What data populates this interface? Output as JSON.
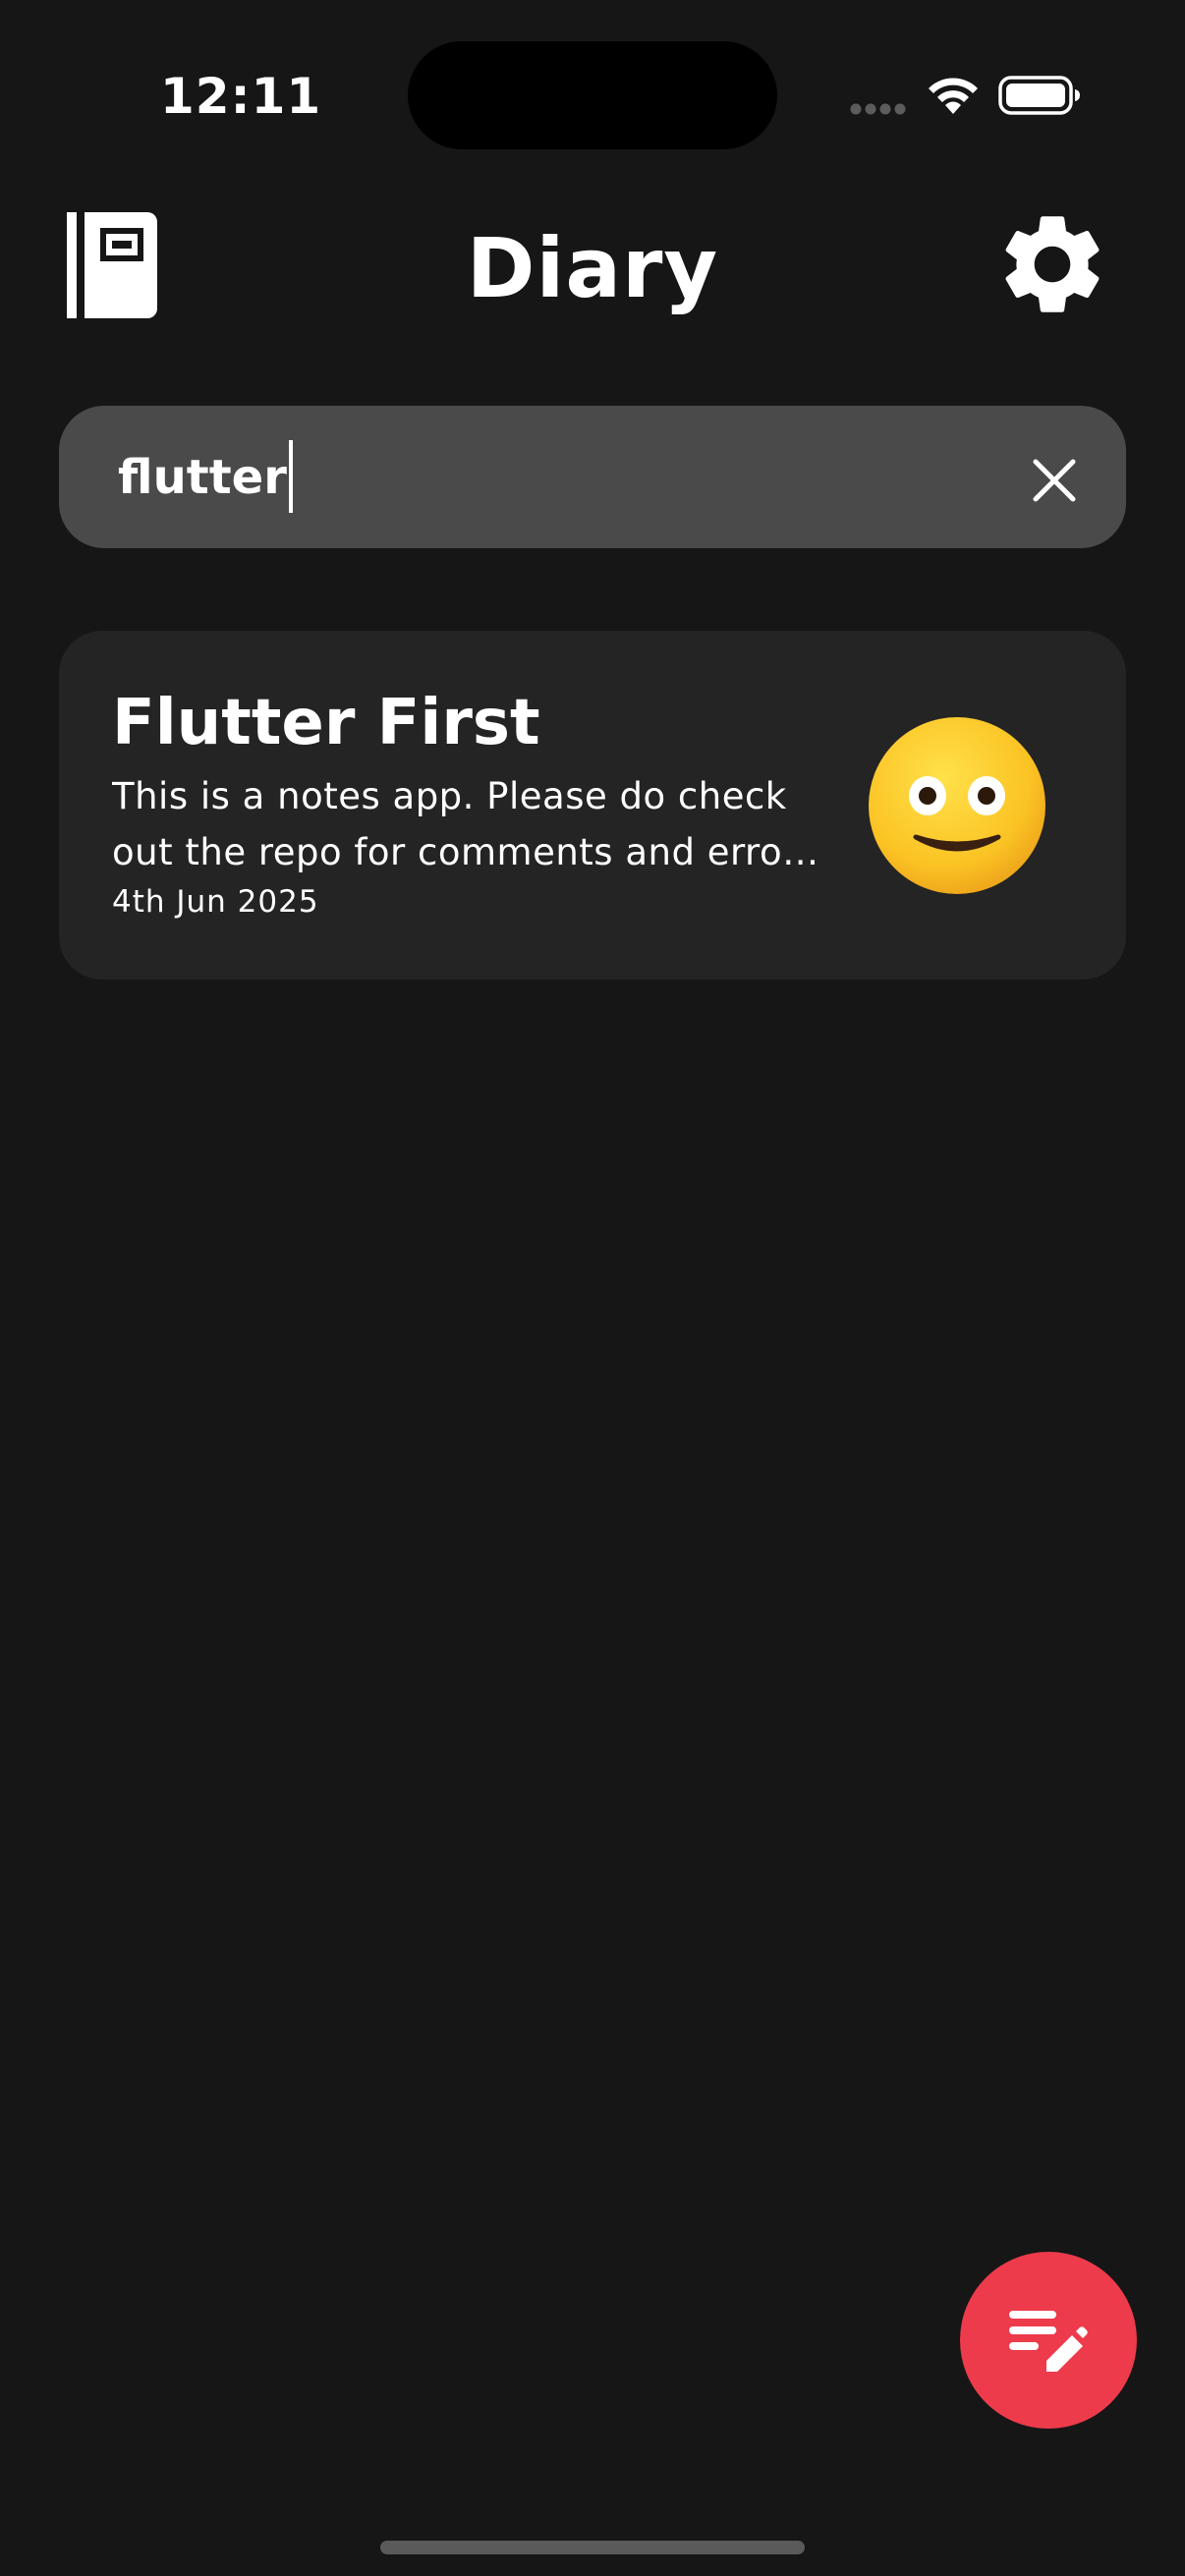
{
  "status_bar": {
    "time": "12:11"
  },
  "header": {
    "title": "Diary",
    "left_icon": "journal-icon",
    "right_icon": "gear-icon"
  },
  "search": {
    "value": "flutter",
    "clear_icon": "close-icon"
  },
  "notes": [
    {
      "title": "Flutter First",
      "body": "This is a notes app. Please do check out the repo for comments and erro…",
      "date": "4th Jun 2025",
      "mood_icon": "slightly-smiling-face-icon"
    }
  ],
  "fab": {
    "icon": "edit-note-icon"
  },
  "colors": {
    "background": "#161616",
    "search_bar": "#4a4a4a",
    "card": "#242424",
    "accent": "#ee3b4c",
    "text": "#ffffff"
  }
}
